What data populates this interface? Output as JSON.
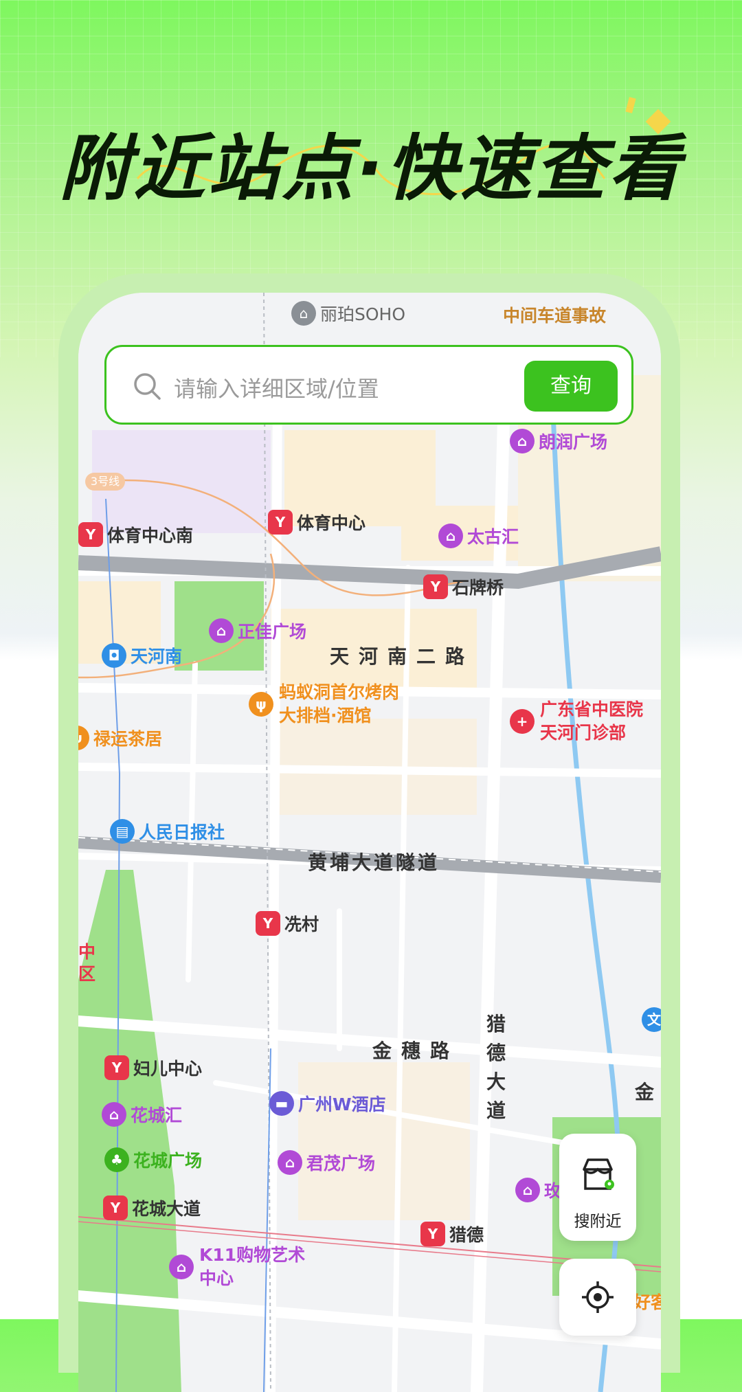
{
  "headline": "附近站点·快速查看",
  "colors": {
    "brand_green": "#3cc21f",
    "metro_red": "#e8364a",
    "mall_purple": "#b14ad6",
    "food_orange": "#f0901e",
    "hospital_red": "#e8364a",
    "news_blue": "#2f8fe6"
  },
  "map": {
    "top_labels": {
      "soho": "丽珀SOHO",
      "accident": "中间车道事故"
    },
    "line_badge": "3号线",
    "roads": {
      "tianhe_nan_2": "天河南二路",
      "huangpu_tunnel": "黄埔大道隧道",
      "jinsui": "金穗路",
      "liede_avenue": "猎德大道",
      "jin_edge": "金"
    },
    "pois": {
      "langrun": "朗润广场",
      "tiyu_zhongxin_nan": "体育中心南",
      "tiyu_zhongxin": "体育中心",
      "taiguhui": "太古汇",
      "shipaiqiao": "石牌桥",
      "zhengjia": "正佳广场",
      "tianhenan": "天河南",
      "mayi_line1": "蚂蚁洞首尔烤肉",
      "mayi_line2": "大排档·酒馆",
      "hospital_line1": "广东省中医院",
      "hospital_line2": "天河门诊部",
      "luyun": "禄运茶居",
      "renmin_ribao": "人民日报社",
      "xiancun": "冼村",
      "funv_zhongxin": "妇儿中心",
      "huachenghui": "花城汇",
      "huacheng_guangchang": "花城广场",
      "huacheng_dadao": "花城大道",
      "w_hotel": "广州W酒店",
      "junmao": "君茂广场",
      "liede": "猎德",
      "k11_line1": "K11购物艺术",
      "k11_line2": "中心",
      "left_edge_top": "中",
      "left_edge_bottom": "区",
      "right_edge_wen": "文",
      "right_bottom": "好客",
      "right_partial": "玫"
    }
  },
  "search": {
    "placeholder": "请输入详细区域/位置",
    "button": "查询"
  },
  "nearby_button": "搜附近"
}
